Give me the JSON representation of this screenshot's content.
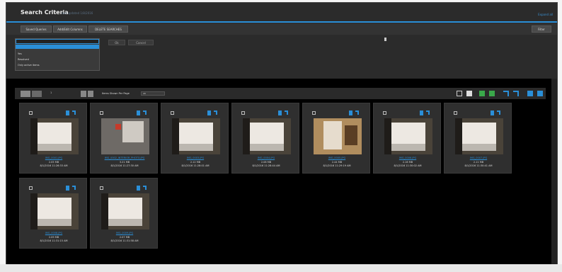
{
  "header": {
    "title": "Search Criteria",
    "subtitle": "last updated 1/8/2016",
    "help": "Expand all"
  },
  "toolbar": {
    "buttons": [
      "Saved Queries",
      "Add/Edit Columns",
      "DELETE SEARCHES"
    ],
    "filter_label": "Filter"
  },
  "criteria": {
    "dropdown_options": [
      "Yes",
      "Resolved",
      "Only active items"
    ],
    "buttons": [
      "Ok",
      "Cancel"
    ]
  },
  "results": {
    "per_page_label": "Items Shown Per Page",
    "per_page_value": "20",
    "page_value": "1"
  },
  "items": [
    {
      "name": "IMG_0001.JPG",
      "size": "2.05 MB",
      "date": "8/1/2016 11:26:33 AM",
      "variant": "paper"
    },
    {
      "name": "IMG_0002_INTERIOR_PHOTO.JPG",
      "size": "3.21 MB",
      "date": "8/1/2016 11:27:30 AM",
      "variant": "interior"
    },
    {
      "name": "IMG_0003.JPG",
      "size": "2.12 MB",
      "date": "8/1/2016 11:28:01 AM",
      "variant": "paper"
    },
    {
      "name": "IMG_0004.JPG",
      "size": "2.08 MB",
      "date": "8/1/2016 11:28:44 AM",
      "variant": "paper"
    },
    {
      "name": "IMG_0005.JPG",
      "size": "2.44 MB",
      "date": "8/1/2016 11:29:19 AM",
      "variant": "warm"
    },
    {
      "name": "IMG_0006.JPG",
      "size": "2.16 MB",
      "date": "8/1/2016 11:30:02 AM",
      "variant": "paper"
    },
    {
      "name": "IMG_0007.JPG",
      "size": "2.11 MB",
      "date": "8/1/2016 11:30:41 AM",
      "variant": "paper"
    },
    {
      "name": "IMG_0008.JPG",
      "size": "2.09 MB",
      "date": "8/1/2016 11:31:15 AM",
      "variant": "paper"
    },
    {
      "name": "IMG_0009.JPG",
      "size": "2.07 MB",
      "date": "8/1/2016 11:31:58 AM",
      "variant": "paper"
    }
  ],
  "colors": {
    "accent": "#2a8fd8",
    "green": "#3aa84a"
  }
}
